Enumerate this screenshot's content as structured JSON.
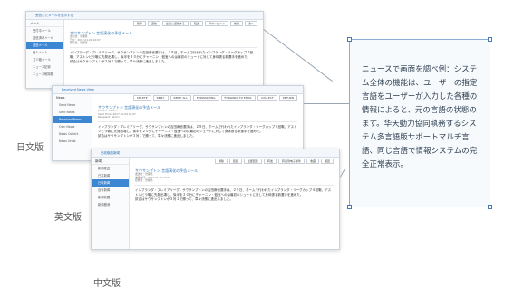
{
  "jp": {
    "caption": "日文版",
    "title": "受信したメールを表示する",
    "sidebar_head": "メール",
    "sidebar": [
      "受付中メール",
      "送信済みメール",
      "送信メール",
      "個人メール",
      "ゴミ箱メール",
      "ニュース記録",
      "ニュース削除箱"
    ],
    "toolbar": [
      "削除",
      "返信",
      "全員に返信する",
      "転送",
      "ダウンロード",
      "前後",
      "次へ"
    ],
    "subject": "サウサンプトン 言語演化の予告メール",
    "meta": [
      "送信者：管理者",
      "日付：2017-01-09 10:07",
      "受信者：管理者"
    ],
    "body": "インプランダ・プレミアリーグ、サウサンプトンの吉田麻也選手は、２９日、ホームで行われたインプランダ・リーグカップ４回戦、アストンビラ戦に先発出場し、後半を２０分にチャーニン・鼓宝へのは最初のシュートに対して身体張る新選手を進めた。",
    "body2": "試合はサウサンプトンが３対１で勝って、準々決勝に進出しました。"
  },
  "en": {
    "caption": "英文版",
    "title": "Received News View",
    "sidebar_head": "News",
    "sidebar": [
      "Send News",
      "Sent News",
      "Received News",
      "Own News",
      "News Collect",
      "News Undo"
    ],
    "toolbar": [
      "DELETE",
      "REPLY",
      "REPLY ALL",
      "FORWARDING",
      "FORWARD TO EMAIL",
      "COLLECT",
      "RETURN"
    ],
    "subject": "サウサンプトン 言語演化の予告メール",
    "meta": [
      "Sender: admin",
      "Send Time: 2017-01-09 10:07",
      "Recipient: admin"
    ],
    "body": "インプランダ・プレミアリーグ、サウサンプトンの吉田麻也選手は、２９日、ホームで行われたインプランダ・リーグカップ４回戦、アストンビラ戦に先発出場し、後半を２０分にチャーニン・鼓宝へのは最初のシュートに対して身体張る新選手を進めた。",
    "body2": "試合はサウサンプトンが３対１で勝って、準々決勝に進出しました。"
  },
  "cn": {
    "caption": "中文版",
    "title": "已收取的新闻",
    "sidebar_head": "新闻",
    "sidebar": [
      "新闻发送",
      "已发新闻",
      "已收新闻",
      "自有新闻",
      "新闻收藏",
      "新闻撤消"
    ],
    "toolbar": [
      "删除",
      "回复",
      "全部回复",
      "转发",
      "转发到电子邮件",
      "收藏",
      "返回"
    ],
    "subject": "サウサンプトン 言語演化の予告メール",
    "meta": [
      "发送者：管理员",
      "发送时间：2017-01-09 10:07",
      "接收者：管理员"
    ],
    "body": "インプランダ・プレミアリーグ、サウサンプトンの吉田麻也選手は、２９日、ホームで行われたインプランダ・リーグカップ４回戦、アストンビラ戦に先発出場し、後半を２０分にチャーニン・鼓宝へのは最初のシュートに対して身体張る新選手を進めた。",
    "body2": "試合はサウサンプトンが３対１で勝って、準々決勝に進出しました。"
  },
  "panel": {
    "text": "ニュースで画面を調べ例：システム全体の機能は、ユーザーの指定言語をユーザーが入力した各種の情報によると、元の言語の状態のます。华天動力協同執務するシステム多言語版サポートマルチ言語、同じ言語で情報システムの完全正常表示。"
  }
}
